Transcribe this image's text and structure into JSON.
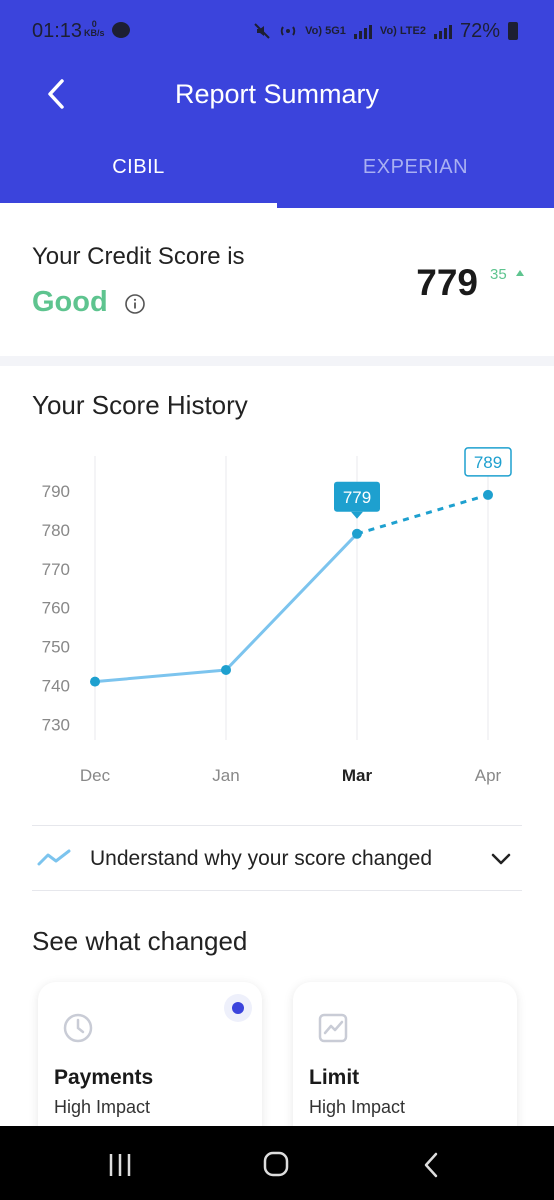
{
  "status_bar": {
    "time": "01:13",
    "data_rate_value": "0",
    "data_rate_unit": "KB/s",
    "network_1": "Vo) 5G1",
    "network_2": "Vo) LTE2",
    "battery": "72%"
  },
  "header": {
    "title": "Report Summary",
    "tabs": [
      {
        "label": "CIBIL",
        "active": true
      },
      {
        "label": "EXPERIAN",
        "active": false
      }
    ]
  },
  "score": {
    "label": "Your Credit Score is",
    "rating": "Good",
    "value": "779",
    "change": "35",
    "change_direction": "up"
  },
  "history": {
    "title": "Your Score History",
    "chart_data": {
      "type": "line",
      "categories": [
        "Dec",
        "Jan",
        "Mar",
        "Apr"
      ],
      "values": [
        741,
        744,
        779,
        789
      ],
      "projected_from_index": 2,
      "highlighted_category": "Mar",
      "value_labels": [
        "779",
        "789"
      ],
      "ytick_labels": [
        "730",
        "740",
        "750",
        "760",
        "770",
        "780",
        "790"
      ],
      "ylim": [
        726,
        799
      ],
      "grid": "vertical",
      "colors": {
        "line": "#7cc4ee",
        "point": "#1ea0cf",
        "label_fill": "#1ea0cf"
      }
    }
  },
  "why_changed": {
    "label": "Understand why your score changed"
  },
  "changes": {
    "title": "See what changed",
    "cards": [
      {
        "name": "Payments",
        "impact": "High Impact",
        "icon": "clock-icon",
        "unread": true
      },
      {
        "name": "Limit",
        "impact": "High Impact",
        "icon": "trend-chart-icon",
        "unread": false
      }
    ]
  },
  "colors": {
    "brand": "#3b44dc",
    "good": "#5ec48f"
  }
}
